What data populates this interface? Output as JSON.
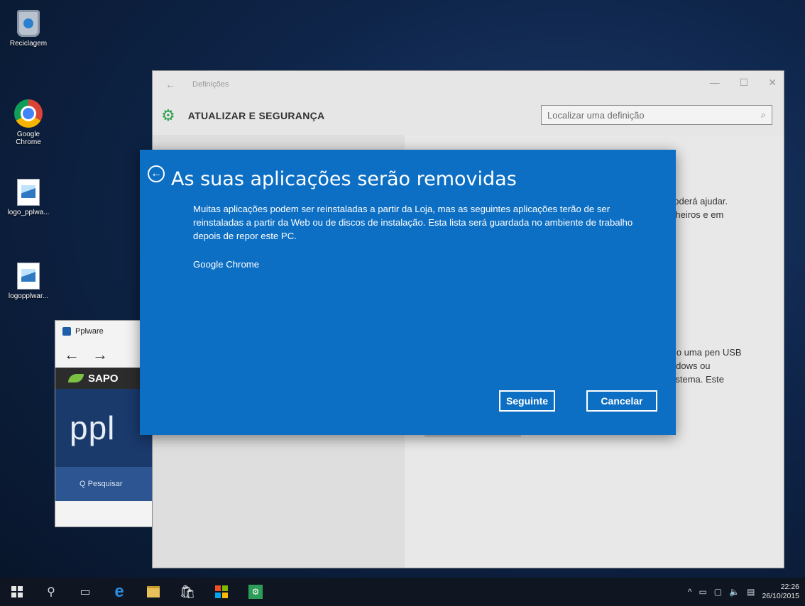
{
  "desktop": {
    "icons": [
      {
        "label": "Reciclagem",
        "icon": "recycle-bin-icon"
      },
      {
        "label": "Google Chrome",
        "icon": "chrome-icon"
      },
      {
        "label": "logo_pplwa...",
        "icon": "image-file-icon"
      },
      {
        "label": "logopplwar...",
        "icon": "image-file-icon"
      }
    ]
  },
  "pplware_window": {
    "title": "Pplware",
    "back_glyph": "←",
    "forward_glyph": "→",
    "sapo_label": "SAPO",
    "banner_text": "ppl",
    "search_label": "Q  Pesquisar"
  },
  "settings_window": {
    "app_title": "Definições",
    "back_glyph": "←",
    "min_glyph": "—",
    "max_glyph": "☐",
    "close_glyph": "✕",
    "section_title": "ATUALIZAR E SEGURANÇA",
    "search_placeholder": "Localizar uma definição",
    "right_pane_fragments": [
      "poderá ajudar.",
      "icheiros e em",
      "mo uma pen USB",
      "indows ou",
      "sistema. Este"
    ]
  },
  "dialog": {
    "title": "As suas aplicações serão removidas",
    "description": "Muitas aplicações podem ser reinstaladas a partir da Loja, mas as seguintes aplicações terão de ser reinstaladas a partir da Web ou de discos de instalação. Esta lista será guardada no ambiente de trabalho depois de repor este PC.",
    "apps": [
      "Google Chrome"
    ],
    "next_label": "Seguinte",
    "cancel_label": "Cancelar"
  },
  "taskbar": {
    "time": "22:26",
    "date": "26/10/2015"
  },
  "colors": {
    "dialog_blue": "#0d6fc4",
    "settings_gear_green": "#2a9d4a",
    "store_red": "#f25022",
    "store_green": "#7fba00",
    "store_blue": "#00a4ef",
    "store_yellow": "#ffb900"
  }
}
